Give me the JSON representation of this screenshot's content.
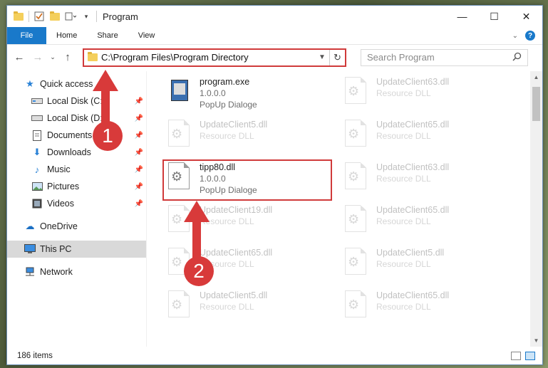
{
  "window": {
    "title": "Program",
    "controls": {
      "minimize": "—",
      "maximize": "☐",
      "close": "✕"
    }
  },
  "ribbon": {
    "tabs": [
      "File",
      "Home",
      "Share",
      "View"
    ],
    "help": "?"
  },
  "address": {
    "path": "C:\\Program Files\\Program Directory",
    "search_placeholder": "Search Program"
  },
  "nav": {
    "items": [
      {
        "label": "Quick access",
        "icon": "star-icon"
      },
      {
        "label": "Local Disk (C:)",
        "icon": "drive-icon",
        "pinned": true
      },
      {
        "label": "Local Disk (D:)",
        "icon": "drive-icon",
        "pinned": true
      },
      {
        "label": "Documents",
        "icon": "documents-icon",
        "pinned": true
      },
      {
        "label": "Downloads",
        "icon": "download-icon",
        "pinned": true
      },
      {
        "label": "Music",
        "icon": "music-icon",
        "pinned": true
      },
      {
        "label": "Pictures",
        "icon": "pictures-icon",
        "pinned": true
      },
      {
        "label": "Videos",
        "icon": "videos-icon",
        "pinned": true
      },
      {
        "label": "OneDrive",
        "icon": "cloud-icon"
      },
      {
        "label": "This PC",
        "icon": "computer-icon",
        "selected": true
      },
      {
        "label": "Network",
        "icon": "network-icon"
      }
    ]
  },
  "files": {
    "col1": [
      {
        "name": "program.exe",
        "meta1": "1.0.0.0",
        "meta2": "PopUp Dialoge",
        "type": "exe"
      },
      {
        "name": "UpdateClient5.dll",
        "meta1": "Resource DLL",
        "meta2": "",
        "type": "dll"
      },
      {
        "name": "tipp80.dll",
        "meta1": "1.0.0.0",
        "meta2": "PopUp Dialoge",
        "type": "dll",
        "highlight": true
      },
      {
        "name": "UpdateClient19.dll",
        "meta1": "Resource DLL",
        "meta2": "",
        "type": "dll"
      },
      {
        "name": "UpdateClient65.dll",
        "meta1": "Resource DLL",
        "meta2": "",
        "type": "dll"
      },
      {
        "name": "UpdateClient5.dll",
        "meta1": "Resource DLL",
        "meta2": "",
        "type": "dll"
      }
    ],
    "col2": [
      {
        "name": "UpdateClient63.dll",
        "meta1": "Resource DLL",
        "meta2": ""
      },
      {
        "name": "UpdateClient65.dll",
        "meta1": "Resource DLL",
        "meta2": ""
      },
      {
        "name": "UpdateClient63.dll",
        "meta1": "Resource DLL",
        "meta2": ""
      },
      {
        "name": "UpdateClient65.dll",
        "meta1": "Resource DLL",
        "meta2": ""
      },
      {
        "name": "UpdateClient5.dll",
        "meta1": "Resource DLL",
        "meta2": ""
      },
      {
        "name": "UpdateClient65.dll",
        "meta1": "Resource DLL",
        "meta2": ""
      }
    ]
  },
  "status": {
    "count": "186 items"
  },
  "annotations": {
    "step1": "1",
    "step2": "2",
    "color": "#d83a3a"
  }
}
